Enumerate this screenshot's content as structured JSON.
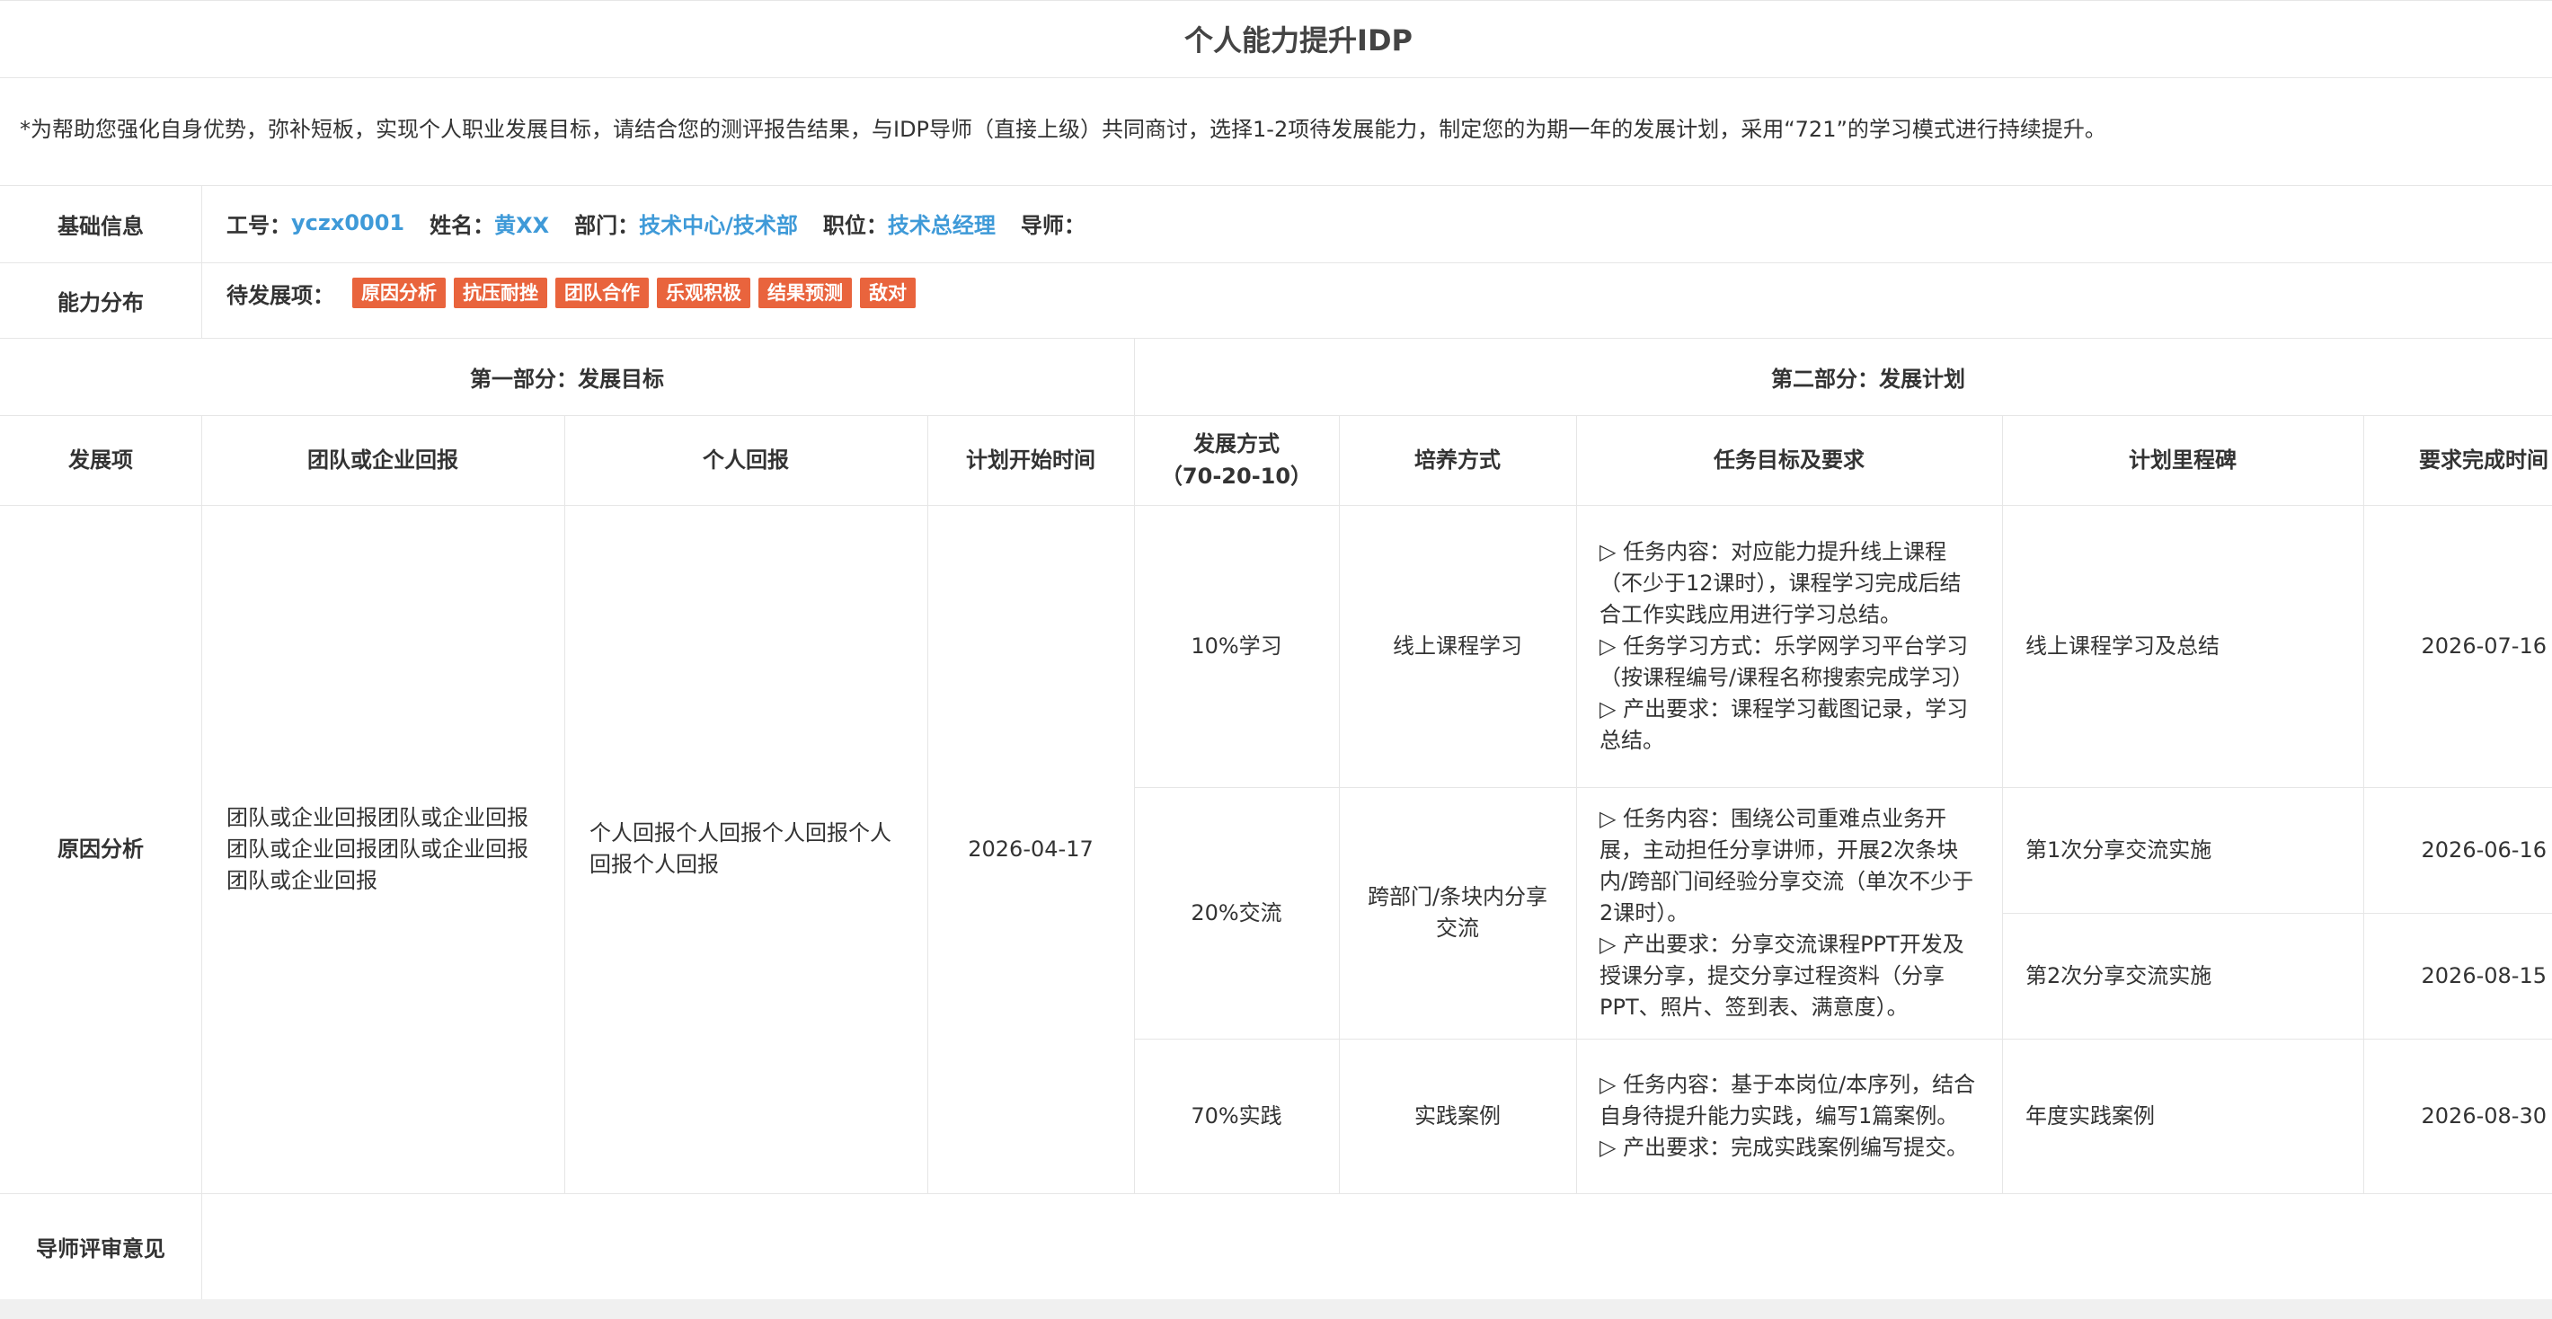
{
  "title": "个人能力提升IDP",
  "notice": "*为帮助您强化自身优势，弥补短板，实现个人职业发展目标，请结合您的测评报告结果，与IDP导师（直接上级）共同商讨，选择1-2项待发展能力，制定您的为期一年的发展计划，采用“721”的学习模式进行持续提升。",
  "basic_info": {
    "label": "基础信息",
    "employee_id_label": "工号：",
    "employee_id": "yczx0001",
    "name_label": "姓名：",
    "name": "黄XX",
    "dept_label": "部门：",
    "dept": "技术中心/技术部",
    "position_label": "职位：",
    "position": "技术总经理",
    "mentor_label": "导师："
  },
  "ability": {
    "label": "能力分布",
    "pending_label": "待发展项：",
    "tags": [
      "原因分析",
      "抗压耐挫",
      "团队合作",
      "乐观积极",
      "结果预测",
      "敌对"
    ],
    "tag_color": "#e9643d"
  },
  "sections": {
    "part1": "第一部分：发展目标",
    "part2": "第二部分：发展计划"
  },
  "headers": {
    "item": "发展项",
    "team_return": "团队或企业回报",
    "personal_return": "个人回报",
    "start_date": "计划开始时间",
    "method": "发展方式",
    "method_sub": "（70-20-10）",
    "training": "培养方式",
    "task": "任务目标及要求",
    "milestone": "计划里程碑",
    "deadline": "要求完成时间"
  },
  "row": {
    "item": "原因分析",
    "team_return": "团队或企业回报团队或企业回报团队或企业回报团队或企业回报团队或企业回报",
    "personal_return": "个人回报个人回报个人回报个人回报个人回报",
    "start_date": "2026-04-17",
    "plans": [
      {
        "method": "10%学习",
        "training": "线上课程学习",
        "task": [
          "▷ 任务内容：对应能力提升线上课程（不少于12课时），课程学习完成后结合工作实践应用进行学习总结。",
          "▷ 任务学习方式：乐学网学习平台学习（按课程编号/课程名称搜索完成学习）",
          "▷ 产出要求：课程学习截图记录，学习总结。"
        ],
        "milestones": [
          {
            "name": "线上课程学习及总结",
            "deadline": "2026-07-16"
          }
        ]
      },
      {
        "method": "20%交流",
        "training": "跨部门/条块内分享交流",
        "task": [
          "▷ 任务内容：围绕公司重难点业务开展，主动担任分享讲师，开展2次条块内/跨部门间经验分享交流（单次不少于2课时）。",
          "▷ 产出要求：分享交流课程PPT开发及授课分享，提交分享过程资料（分享PPT、照片、签到表、满意度）。"
        ],
        "milestones": [
          {
            "name": "第1次分享交流实施",
            "deadline": "2026-06-16"
          },
          {
            "name": "第2次分享交流实施",
            "deadline": "2026-08-15"
          }
        ]
      },
      {
        "method": "70%实践",
        "training": "实践案例",
        "task": [
          "▷ 任务内容：基于本岗位/本序列，结合自身待提升能力实践，编写1篇案例。 ▷ 产出要求：完成实践案例编写提交。"
        ],
        "milestones": [
          {
            "name": "年度实践案例",
            "deadline": "2026-08-30"
          }
        ]
      }
    ]
  },
  "mentor_review": {
    "label": "导师评审意见",
    "value": ""
  }
}
